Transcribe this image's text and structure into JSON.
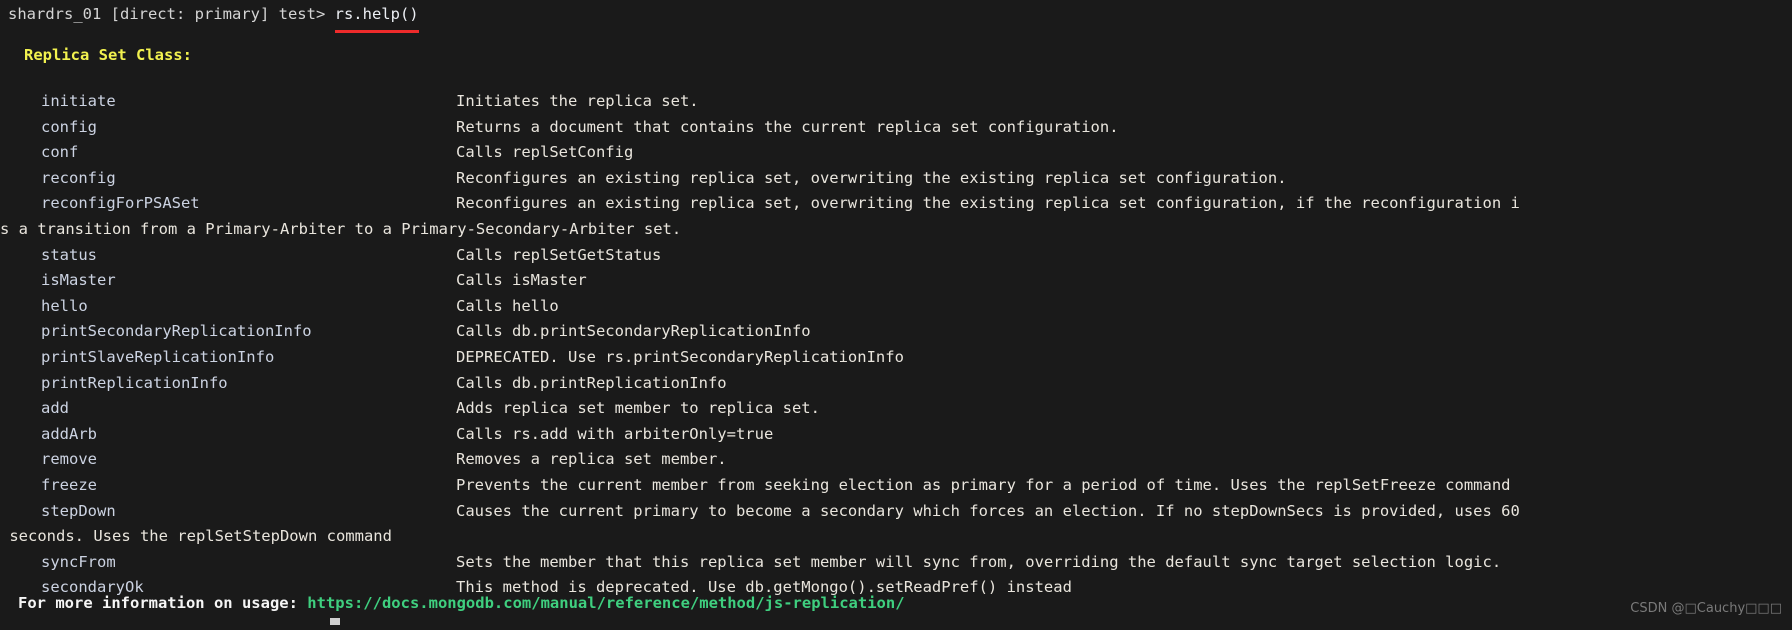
{
  "terminal": {
    "background_color": "#1a1a1a",
    "prompt": {
      "prefix": "shardrs_01 [direct: primary] test> ",
      "command": "rs.help()",
      "underline_color": "#ee2b2b"
    },
    "heading": "Replica Set Class:",
    "heading_color": "#f2f24f",
    "method_name_color": "#ccd3e2",
    "description_color": "#e9e5dd",
    "rows": [
      {
        "name": "initiate",
        "desc": "Initiates the replica set."
      },
      {
        "name": "config",
        "desc": "Returns a document that contains the current replica set configuration."
      },
      {
        "name": "conf",
        "desc": "Calls replSetConfig"
      },
      {
        "name": "reconfig",
        "desc": "Reconfigures an existing replica set, overwriting the existing replica set configuration."
      },
      {
        "name": "reconfigForPSASet",
        "desc": "Reconfigures an existing replica set, overwriting the existing replica set configuration, if the reconfiguration i",
        "wrap": "s a transition from a Primary-Arbiter to a Primary-Secondary-Arbiter set."
      },
      {
        "name": "status",
        "desc": "Calls replSetGetStatus"
      },
      {
        "name": "isMaster",
        "desc": "Calls isMaster"
      },
      {
        "name": "hello",
        "desc": "Calls hello"
      },
      {
        "name": "printSecondaryReplicationInfo",
        "desc": "Calls db.printSecondaryReplicationInfo"
      },
      {
        "name": "printSlaveReplicationInfo",
        "desc": "DEPRECATED. Use rs.printSecondaryReplicationInfo"
      },
      {
        "name": "printReplicationInfo",
        "desc": "Calls db.printReplicationInfo"
      },
      {
        "name": "add",
        "desc": "Adds replica set member to replica set."
      },
      {
        "name": "addArb",
        "desc": "Calls rs.add with arbiterOnly=true"
      },
      {
        "name": "remove",
        "desc": "Removes a replica set member."
      },
      {
        "name": "freeze",
        "desc": "Prevents the current member from seeking election as primary for a period of time. Uses the replSetFreeze command"
      },
      {
        "name": "stepDown",
        "desc": "Causes the current primary to become a secondary which forces an election. If no stepDownSecs is provided, uses 60",
        "wrap": " seconds. Uses the replSetStepDown command"
      },
      {
        "name": "syncFrom",
        "desc": "Sets the member that this replica set member will sync from, overriding the default sync target selection logic."
      },
      {
        "name": "secondaryOk",
        "desc": "This method is deprecated. Use db.getMongo().setReadPref() instead"
      }
    ],
    "footer": {
      "label": "For more information on usage: ",
      "url": "https://docs.mongodb.com/manual/reference/method/js-replication/",
      "url_color": "#3fcf7f"
    },
    "watermark": "CSDN @□Cauchy□□□"
  }
}
